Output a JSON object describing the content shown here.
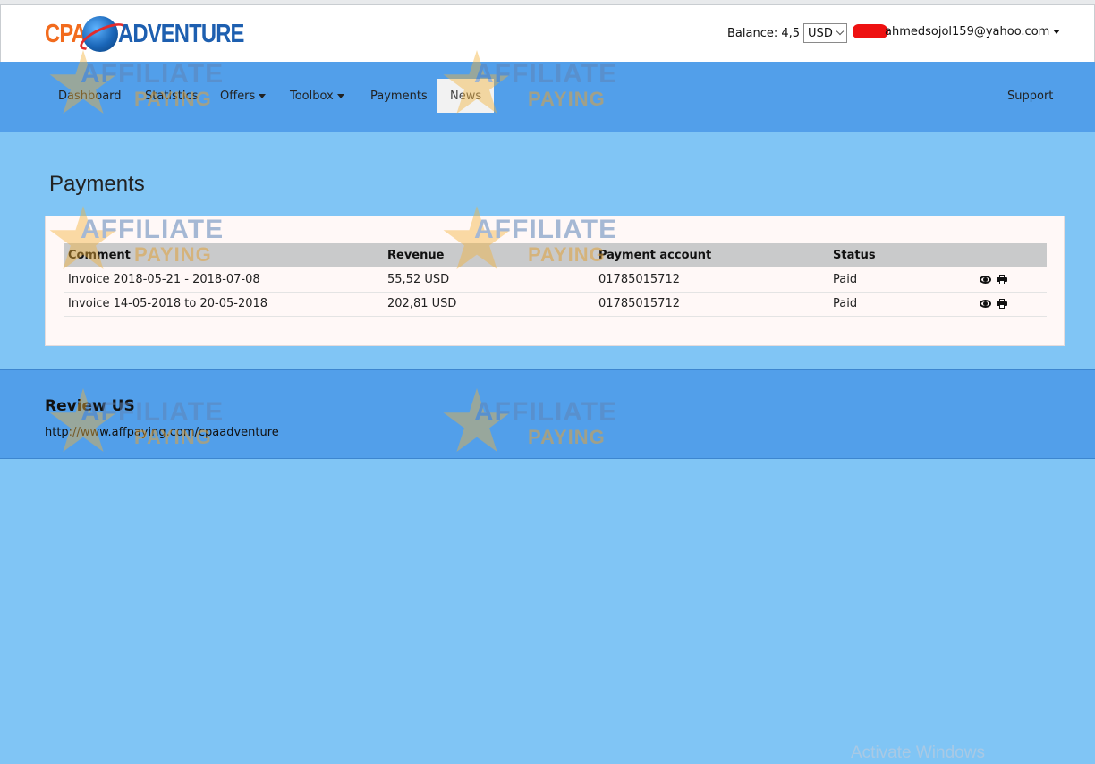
{
  "header": {
    "logo_left": "CPA",
    "logo_right": "ADVENTURE",
    "balance_label": "Balance: 4,5",
    "currency": "USD",
    "user_email": "ahmedsojol159@yahoo.com"
  },
  "nav": {
    "items": [
      {
        "label": "Dashboard"
      },
      {
        "label": "Statistics"
      },
      {
        "label": "Offers"
      },
      {
        "label": "Toolbox"
      },
      {
        "label": "Payments"
      },
      {
        "label": "News"
      }
    ],
    "support": "Support"
  },
  "page": {
    "title": "Payments"
  },
  "table": {
    "headers": [
      "Comment",
      "Revenue",
      "Payment account",
      "Status",
      ""
    ],
    "rows": [
      {
        "comment": "Invoice 2018-05-21 - 2018-07-08",
        "revenue": "55,52 USD",
        "account": "01785015712",
        "status": "Paid"
      },
      {
        "comment": "Invoice 14-05-2018 to 20-05-2018",
        "revenue": "202,81 USD",
        "account": "01785015712",
        "status": "Paid"
      }
    ]
  },
  "footer": {
    "title": "Review US",
    "link": "http://www.affpaying.com/cpaadventure"
  },
  "watermark": {
    "line1": "AFFILIATE",
    "line2": "PAYING"
  },
  "os_overlay": "Activate Windows",
  "colors": {
    "nav_bg": "#529fea",
    "page_bg": "#80c5f5",
    "paid": "#4cae4c"
  }
}
